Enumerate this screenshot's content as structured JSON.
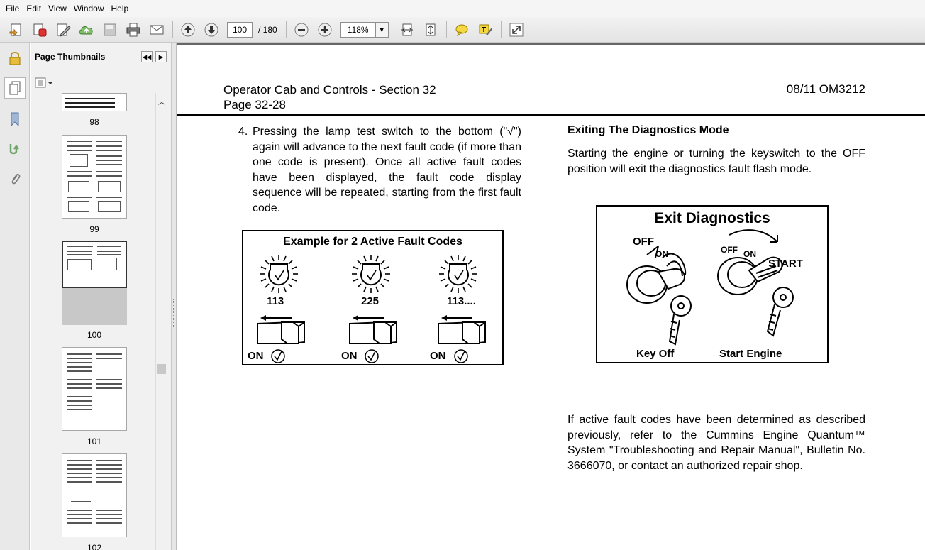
{
  "menu": [
    "File",
    "Edit",
    "View",
    "Window",
    "Help"
  ],
  "toolbar": {
    "page_current": "100",
    "page_total": "/ 180",
    "zoom": "118%"
  },
  "sidebar": {
    "title": "Page Thumbnails",
    "thumbnails": [
      {
        "label": "98"
      },
      {
        "label": "99"
      },
      {
        "label": "100"
      },
      {
        "label": "101"
      },
      {
        "label": "102"
      }
    ]
  },
  "document": {
    "header_title_line1": "Operator Cab and Controls - Section 32",
    "header_title_line2": "Page 32-28",
    "header_right": "08/11  OM3212",
    "item_number": "4.",
    "item_text": "Pressing the lamp test switch to the bottom (\"√\") again will advance to the next fault code (if more than one code is present). Once all active fault codes have been displayed, the fault code display sequence will be repeated, starting from the first fault code.",
    "exit_heading": "Exiting The Diagnostics Mode",
    "exit_text": "Starting the engine or turning the keyswitch to the OFF position will exit the diagnostics fault flash mode.",
    "bottom_text": "If active fault codes have been determined as described previously, refer to the Cummins Engine Quantum™ System \"Troubleshooting and Repair Manual\", Bulletin No. 3666070, or contact an authorized repair shop.",
    "figure1": {
      "title": "Example for 2 Active Fault Codes",
      "codes": [
        "113",
        "225",
        "113...."
      ],
      "on_label": "ON"
    },
    "figure2": {
      "title": "Exit Diagnostics",
      "off": "OFF",
      "on": "ON",
      "start": "START",
      "key_off": "Key Off",
      "start_engine": "Start Engine"
    }
  }
}
